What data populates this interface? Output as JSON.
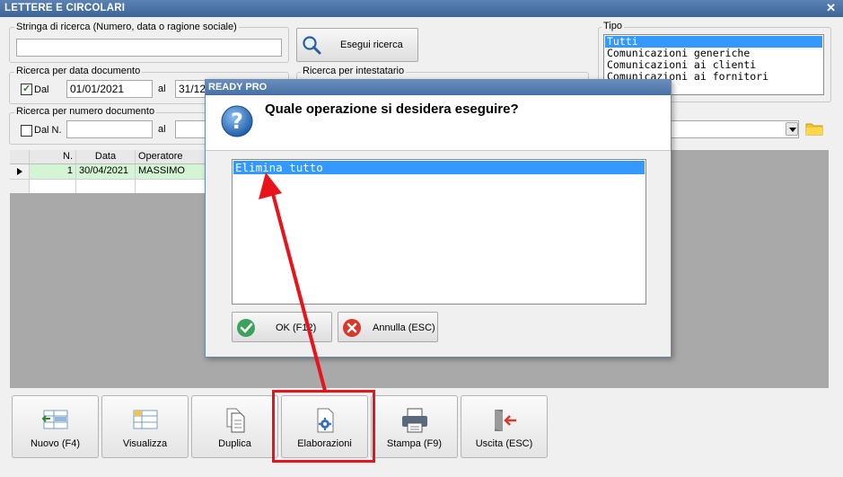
{
  "window": {
    "title": "LETTERE E CIRCOLARI",
    "close_glyph": "✕"
  },
  "search": {
    "group_label": "Stringa di ricerca (Numero, data o ragione sociale)",
    "value": "",
    "button_label": "Esegui ricerca"
  },
  "date_search": {
    "group_label": "Ricerca per data documento",
    "checkbox_label": "Dal",
    "from": "01/01/2021",
    "to_label": "al",
    "to": "31/12/2021"
  },
  "holder_search": {
    "group_label": "Ricerca per intestatario"
  },
  "number_search": {
    "group_label": "Ricerca per numero documento",
    "checkbox_label": "Dal N.",
    "from": "",
    "to_label": "al",
    "to": ""
  },
  "tipo": {
    "label": "Tipo",
    "items": [
      "Tutti",
      "Comunicazioni generiche",
      "Comunicazioni ai clienti",
      "Comunicazioni ai fornitori"
    ],
    "selected_index": 0
  },
  "grid": {
    "columns": [
      "N.",
      "Data",
      "Operatore"
    ],
    "rows": [
      {
        "n": "1",
        "data": "30/04/2021",
        "operatore": "MASSIMO"
      }
    ]
  },
  "toolbar": {
    "buttons": [
      {
        "label": "Nuovo (F4)",
        "icon": "new-record-icon"
      },
      {
        "label": "Visualizza",
        "icon": "view-grid-icon"
      },
      {
        "label": "Duplica",
        "icon": "duplicate-icon"
      },
      {
        "label": "Elaborazioni",
        "icon": "gear-document-icon"
      },
      {
        "label": "Stampa (F9)",
        "icon": "printer-icon"
      },
      {
        "label": "Uscita (ESC)",
        "icon": "exit-door-icon"
      }
    ]
  },
  "dialog": {
    "title": "READY PRO",
    "question": "Quale operazione si desidera eseguire?",
    "options": [
      "Elimina tutto"
    ],
    "selected_index": 0,
    "ok_label": "OK (F12)",
    "cancel_label": "Annulla (ESC)"
  },
  "colors": {
    "title_bar": "#3c6598",
    "selection": "#3399ff",
    "grid_background": "#a9a9a9",
    "row_highlight": "#d4f5d4",
    "annotation_red": "#e8131b"
  }
}
